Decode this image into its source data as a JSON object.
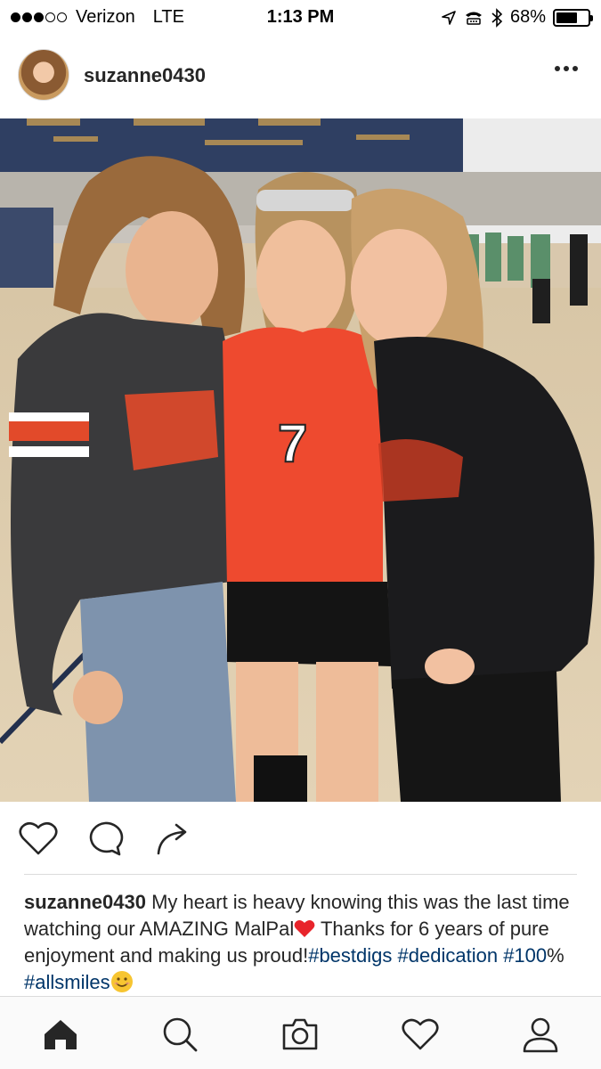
{
  "status_bar": {
    "carrier": "Verizon",
    "network": "LTE",
    "time": "1:13 PM",
    "battery_text": "68%",
    "battery_level": 0.68,
    "signal_bars_filled": 3,
    "signal_bars_total": 5,
    "icons": [
      "location-arrow-icon",
      "tty-icon",
      "bluetooth-icon",
      "battery-icon"
    ]
  },
  "post": {
    "username": "suzanne0430",
    "avatar_icon": "avatar",
    "more_icon": "more-options-icon",
    "photo_description_icon": "post-photo",
    "actions": [
      "heart-icon",
      "comment-icon",
      "share-icon"
    ],
    "caption": {
      "username": "suzanne0430",
      "text_1": "My heart is heavy knowing this was the last time watching our AMAZING MalPal",
      "text_2": "Thanks for 6 years of pure enjoyment and making us proud!",
      "tag_1": "#bestdigs",
      "tag_2": "#dedication",
      "tag_3": "#100",
      "percent": "%",
      "tag_4": "#allsmiles"
    }
  },
  "tab_bar": {
    "tabs": [
      "home-icon",
      "search-icon",
      "camera-icon",
      "activity-heart-icon",
      "profile-icon"
    ]
  },
  "colors": {
    "hashtag": "#003569",
    "text": "#262626",
    "divider": "#dbdbdb",
    "tab_bar_bg": "#fafafa"
  }
}
